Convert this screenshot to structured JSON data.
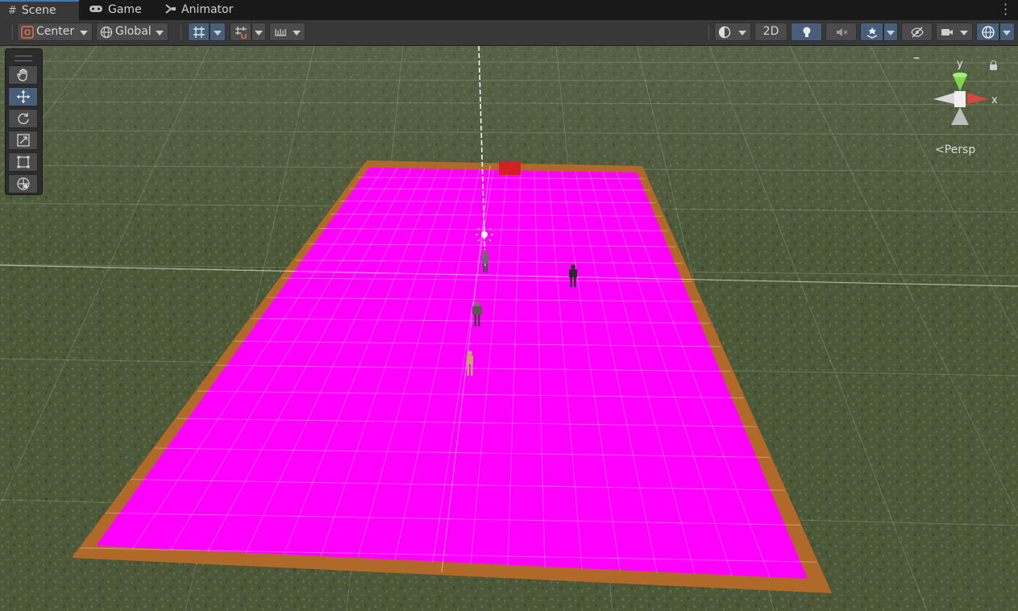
{
  "tabs": [
    {
      "label": "Scene",
      "icon": "grid-hash-icon",
      "active": true
    },
    {
      "label": "Game",
      "icon": "gamepad-icon",
      "active": false
    },
    {
      "label": "Animator",
      "icon": "animator-icon",
      "active": false
    }
  ],
  "toolbar": {
    "pivot_label": "Center",
    "space_label": "Global",
    "mode_2d_label": "2D"
  },
  "tools": [
    "hand-tool",
    "move-tool",
    "rotate-tool",
    "scale-tool",
    "rect-tool",
    "transform-tool"
  ],
  "gizmo": {
    "y_label": "y",
    "x_label": "x",
    "projection_label": "Persp"
  },
  "colors": {
    "ground_material": "#ff00ff",
    "border": "#b1692a",
    "flag": "#d42020",
    "axis_y": "#79d84a",
    "axis_x": "#d6483c",
    "grass": "#4d5a3b"
  }
}
